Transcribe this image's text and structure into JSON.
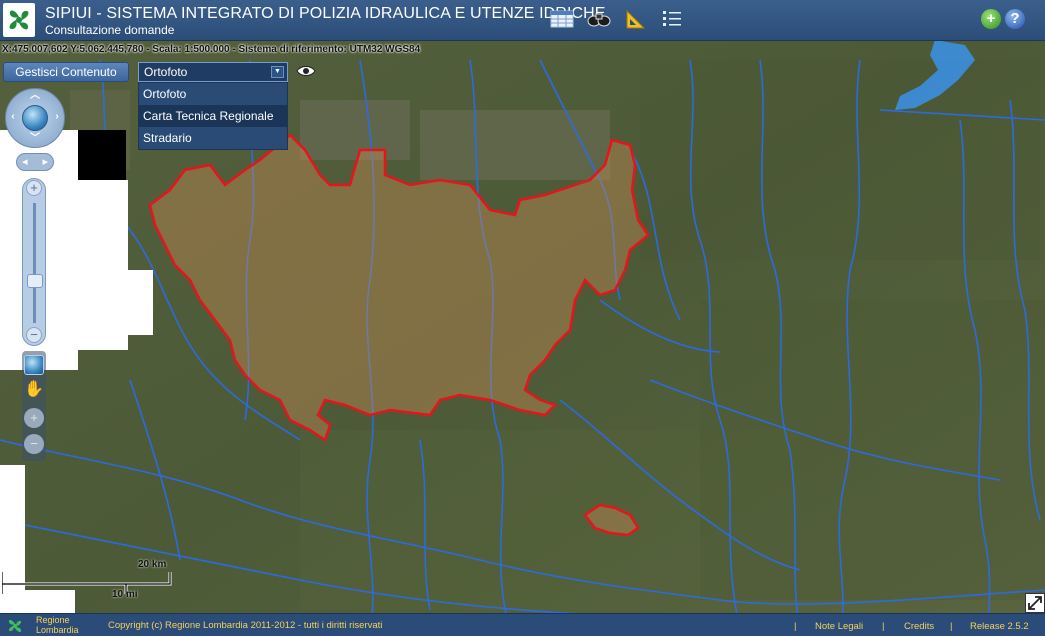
{
  "app": {
    "title": "SIPIUI - SISTEMA INTEGRATO DI POLIZIA IDRAULICA E UTENZE IDRICHE",
    "subtitle": "Consultazione domande"
  },
  "coordinates": {
    "text": "X:475.007,602 Y:5.062.445,780 - Scala: 1:500.000 - Sistema di riferimento: UTM32 WGS84"
  },
  "controls": {
    "gestisci_label": "Gestisci Contenuto",
    "layer_selected": "Ortofoto",
    "layer_options": [
      "Ortofoto",
      "Carta Tecnica Regionale",
      "Stradario"
    ]
  },
  "scale": {
    "km_label": "20 km",
    "mi_label": "10 mi"
  },
  "footer": {
    "org_line1": "Regione",
    "org_line2": "Lombardia",
    "copyright": "Copyright (c) Regione Lombardia 2011-2012 - tutti i diritti riservati",
    "sep": "|",
    "links": [
      "Note Legali",
      "Credits",
      "Release 2.5.2"
    ]
  },
  "colors": {
    "header": "#2c4d78",
    "boundary": "#e8141c",
    "river": "#2a6cf0",
    "footer_text": "#f2d25a",
    "logo_green": "#1e8c3a"
  },
  "icons": {
    "header": [
      "table-icon",
      "binoculars-icon",
      "ruler-icon",
      "list-icon",
      "add-icon",
      "help-icon"
    ],
    "map": [
      "eye-icon",
      "globe-icon",
      "hand-icon",
      "zoom-plus-icon",
      "zoom-minus-icon",
      "fullscreen-icon"
    ]
  }
}
